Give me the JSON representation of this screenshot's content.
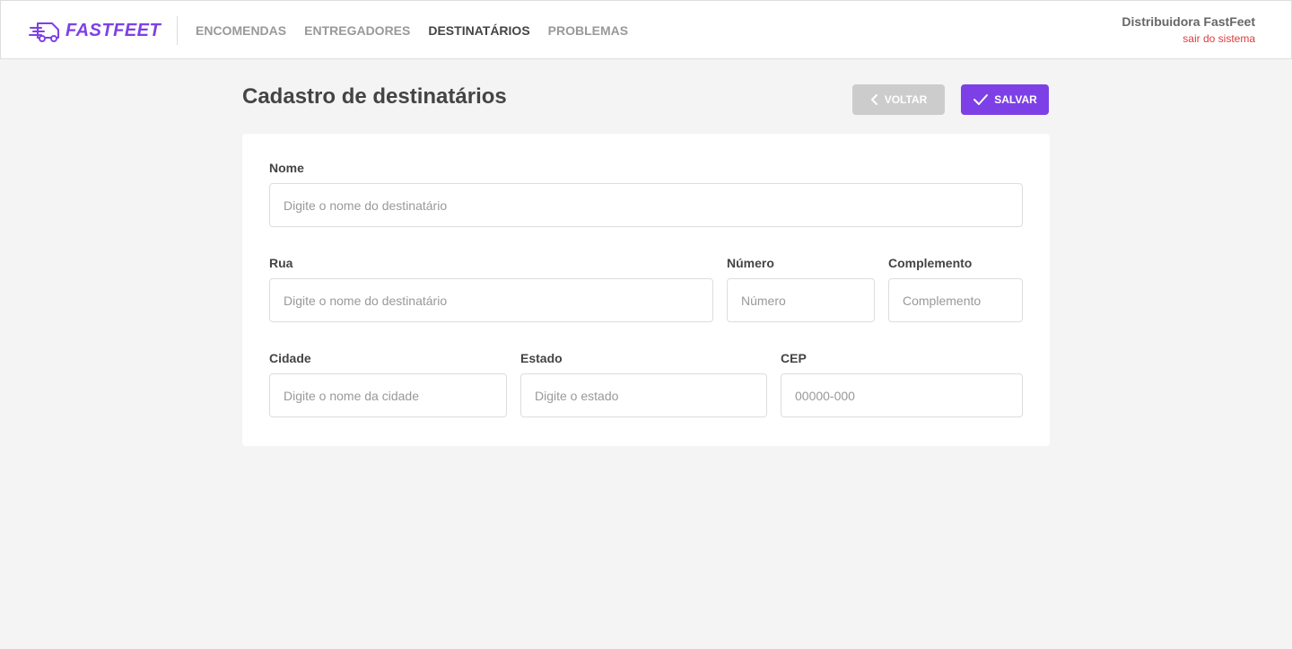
{
  "app": {
    "brand": "FASTFEET",
    "brand_color": "#7d40e7"
  },
  "nav": {
    "items": [
      {
        "label": "ENCOMENDAS",
        "active": false
      },
      {
        "label": "ENTREGADORES",
        "active": false
      },
      {
        "label": "DESTINATÁRIOS",
        "active": true
      },
      {
        "label": "PROBLEMAS",
        "active": false
      }
    ]
  },
  "user": {
    "name": "Distribuidora FastFeet",
    "logout_label": "sair do sistema"
  },
  "page": {
    "title": "Cadastro de destinatários",
    "back_label": "VOLTAR",
    "save_label": "SALVAR"
  },
  "form": {
    "nome": {
      "label": "Nome",
      "placeholder": "Digite o nome do destinatário",
      "value": ""
    },
    "rua": {
      "label": "Rua",
      "placeholder": "Digite o nome do destinatário",
      "value": ""
    },
    "numero": {
      "label": "Número",
      "placeholder": "Número",
      "value": ""
    },
    "complemento": {
      "label": "Complemento",
      "placeholder": "Complemento",
      "value": ""
    },
    "cidade": {
      "label": "Cidade",
      "placeholder": "Digite o nome da cidade",
      "value": ""
    },
    "estado": {
      "label": "Estado",
      "placeholder": "Digite o estado",
      "value": ""
    },
    "cep": {
      "label": "CEP",
      "placeholder": "00000-000",
      "value": ""
    }
  },
  "colors": {
    "accent": "#7d40e7",
    "back_button": "#cccccc",
    "logout": "#de3b3b",
    "background": "#f4f4f4"
  },
  "icons": {
    "logo": "delivery-truck-icon",
    "back": "chevron-left-icon",
    "save": "check-icon"
  }
}
